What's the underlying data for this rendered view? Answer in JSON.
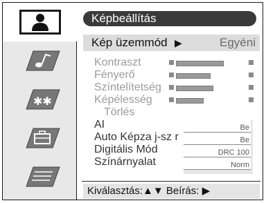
{
  "menu": {
    "title": "Képbeállítás",
    "mode": {
      "label": "Kép üzemmód",
      "arrow": "▶",
      "value": "Egyéni"
    },
    "sliders": [
      {
        "label": "Kontraszt",
        "level": 0.67
      },
      {
        "label": "Fényerő",
        "level": 0.48
      },
      {
        "label": "Színtelítetség",
        "level": 0.52
      },
      {
        "label": "Képélesség",
        "level": 0.38
      }
    ],
    "reset": "Törlés",
    "options": [
      {
        "label": "AI",
        "value": "Be"
      },
      {
        "label": "Auto Képza j-sz r",
        "value": "Be"
      },
      {
        "label": "Digitális Mód",
        "value": "DRC 100"
      },
      {
        "label": "Színárnyalat",
        "value": "Norm"
      }
    ],
    "footer": "Kiválasztás:▲▼ Beírás: ▶"
  },
  "tabs": [
    {
      "icon": "person-icon",
      "active": true
    },
    {
      "icon": "music-note-icon",
      "active": false
    },
    {
      "icon": "stars-icon",
      "active": false
    },
    {
      "icon": "briefcase-icon",
      "active": false
    },
    {
      "icon": "document-lines-icon",
      "active": false
    }
  ]
}
